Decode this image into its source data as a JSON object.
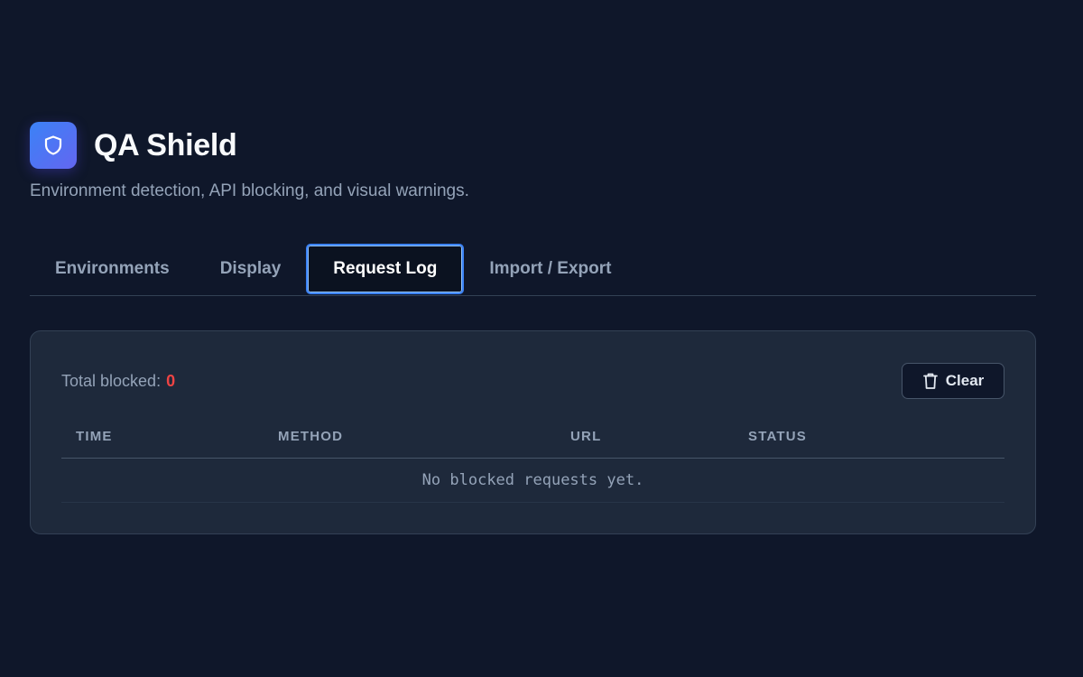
{
  "app": {
    "title": "QA Shield",
    "subtitle": "Environment detection, API blocking, and visual warnings."
  },
  "tabs": [
    {
      "label": "Environments",
      "active": false
    },
    {
      "label": "Display",
      "active": false
    },
    {
      "label": "Request Log",
      "active": true
    },
    {
      "label": "Import / Export",
      "active": false
    }
  ],
  "log": {
    "total_label": "Total blocked:",
    "total_count": "0",
    "clear_label": "Clear",
    "columns": [
      "TIME",
      "METHOD",
      "URL",
      "STATUS"
    ],
    "empty_message": "No blocked requests yet."
  },
  "icons": {
    "logo": "shield-icon",
    "clear": "trash-icon"
  },
  "colors": {
    "background": "#0f172a",
    "panel": "#1e293b",
    "accent": "#3b82f6",
    "count_red": "#ef4444"
  }
}
